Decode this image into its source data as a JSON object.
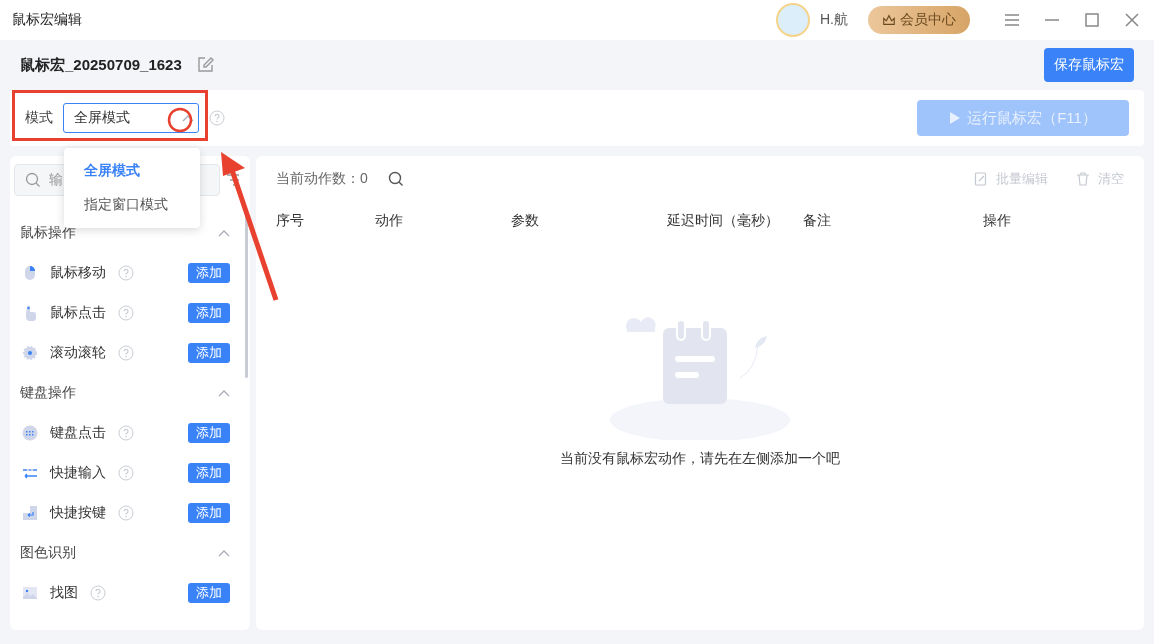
{
  "window": {
    "title": "鼠标宏编辑",
    "user": "H.航",
    "vip_button": "会员中心"
  },
  "header": {
    "macro_name": "鼠标宏_20250709_1623",
    "save_button": "保存鼠标宏"
  },
  "mode": {
    "label": "模式",
    "value": "全屏模式",
    "expanded": true,
    "options": [
      {
        "label": "全屏模式",
        "selected": true
      },
      {
        "label": "指定窗口模式",
        "selected": false
      }
    ],
    "run_button": {
      "label": "运行鼠标宏（F11）",
      "disabled": true
    }
  },
  "sidebar": {
    "search": {
      "placeholder": "输"
    },
    "groups": [
      {
        "title": "鼠标操作",
        "expanded": true,
        "items": [
          {
            "label": "鼠标移动",
            "button": "添加"
          },
          {
            "label": "鼠标点击",
            "button": "添加"
          },
          {
            "label": "滚动滚轮",
            "button": "添加"
          }
        ]
      },
      {
        "title": "键盘操作",
        "expanded": true,
        "items": [
          {
            "label": "键盘点击",
            "button": "添加"
          },
          {
            "label": "快捷输入",
            "button": "添加"
          },
          {
            "label": "快捷按键",
            "button": "添加"
          }
        ]
      },
      {
        "title": "图色识别",
        "expanded": true,
        "items": [
          {
            "label": "找图",
            "button": "添加"
          }
        ]
      }
    ]
  },
  "table": {
    "count_label": "当前动作数：0",
    "actions": [
      {
        "label": "批量编辑",
        "disabled": true
      },
      {
        "label": "清空",
        "disabled": true
      }
    ],
    "columns": [
      "序号",
      "动作",
      "参数",
      "延迟时间（毫秒）",
      "备注",
      "操作"
    ],
    "empty_message": "当前没有鼠标宏动作，请先在左侧添加一个吧"
  }
}
